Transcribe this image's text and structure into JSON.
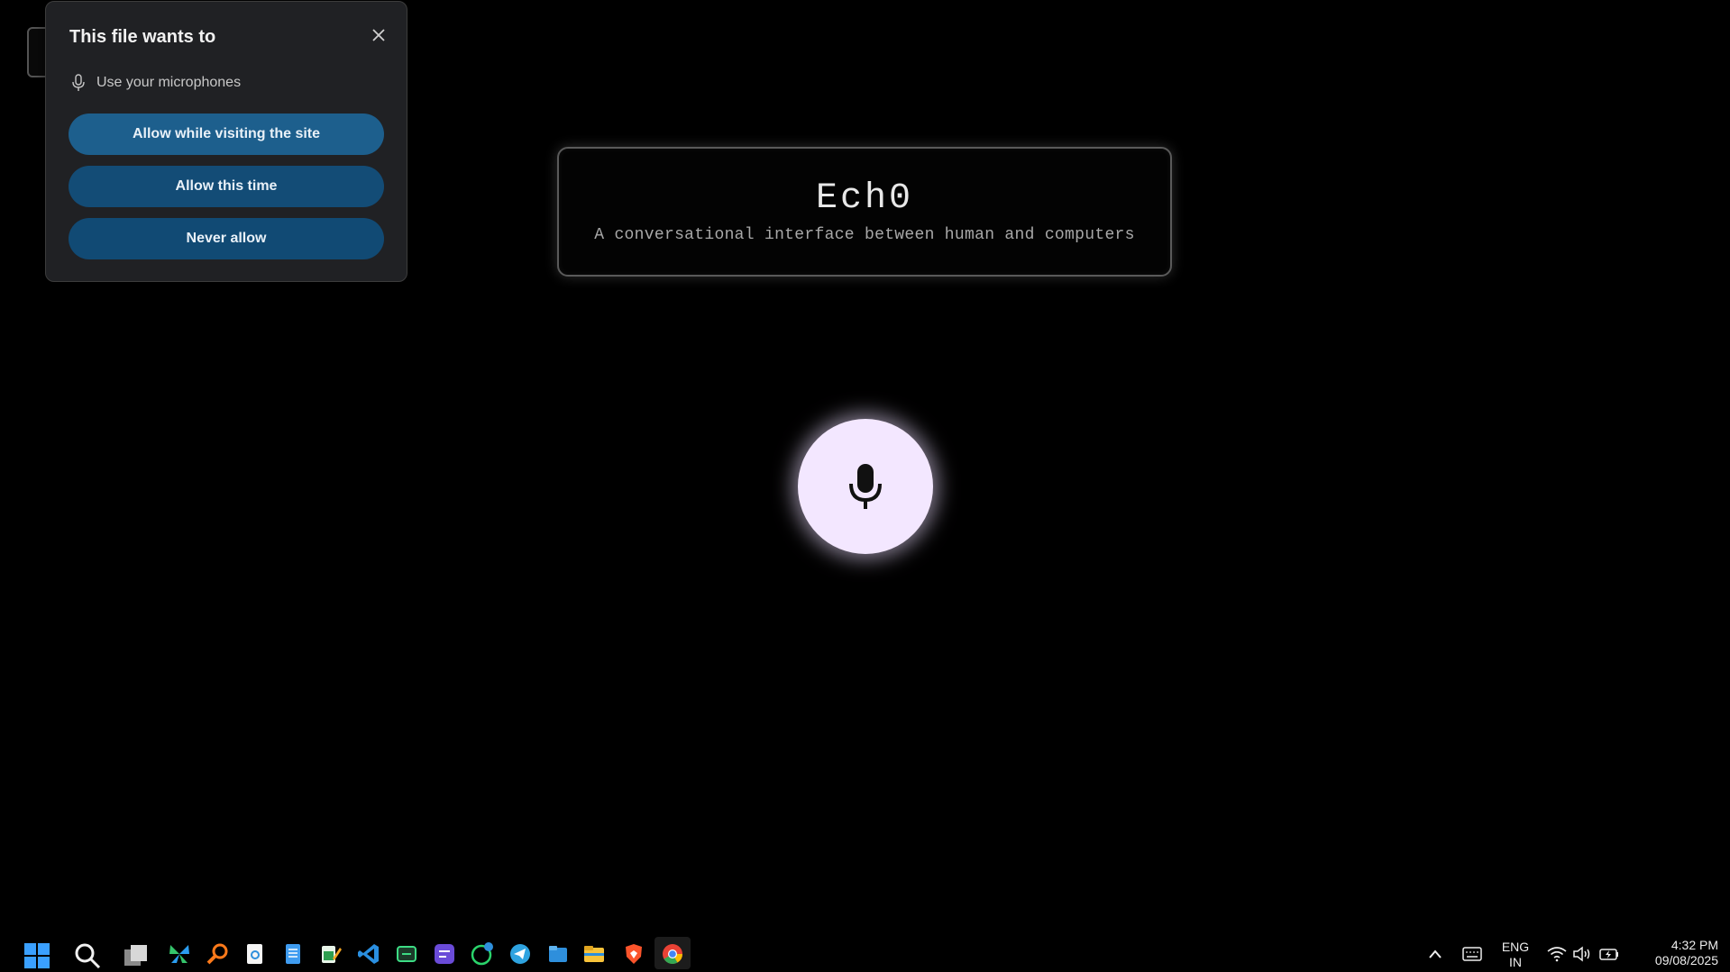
{
  "permission_popup": {
    "title": "This file wants to",
    "permission_item": "Use your microphones",
    "buttons": {
      "allow_while_visiting": "Allow while visiting the site",
      "allow_this_time": "Allow this time",
      "never_allow": "Never allow"
    }
  },
  "hero": {
    "title": "Ech0",
    "subtitle": "A conversational interface between human and computers"
  },
  "taskbar": {
    "icons": [
      "windows-start-icon",
      "search-icon",
      "task-view-icon",
      "butterfly-app-icon",
      "search-magnifier-app-icon",
      "document-viewer-icon",
      "notepad-icon",
      "spreadsheet-edit-icon",
      "vscode-icon",
      "terminal-app-icon",
      "purple-app-icon",
      "whatsapp-icon",
      "telegram-icon",
      "files-app-icon",
      "file-explorer-icon",
      "brave-browser-icon",
      "chrome-icon"
    ],
    "tray": {
      "language_top": "ENG",
      "language_bottom": "IN",
      "time": "4:32 PM",
      "date": "09/08/2025"
    }
  },
  "colors": {
    "background": "#000000",
    "mic_button": "#f3e7ff",
    "popup_bg": "#202124",
    "button_primary": "#1d5f8d",
    "button_secondary": "#134c76"
  }
}
